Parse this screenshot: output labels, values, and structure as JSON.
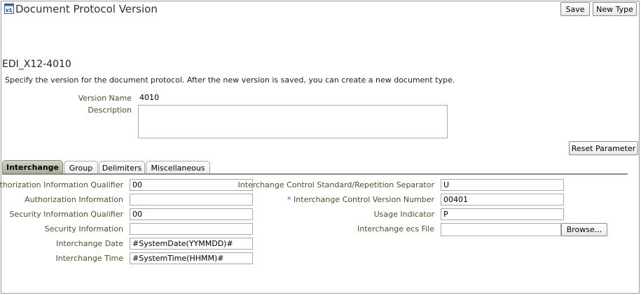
{
  "header": {
    "title": "Document Protocol Version",
    "save_label": "Save",
    "new_type_label": "New Type"
  },
  "section": {
    "title": "EDI_X12-4010",
    "instructions": "Specify the version for the document protocol. After the new version is saved, you can create a new document type."
  },
  "form": {
    "version_name_label": "Version Name",
    "version_name_value": "4010",
    "description_label": "Description",
    "description_value": "",
    "reset_label": "Reset Parameter"
  },
  "tabs": [
    {
      "label": "Interchange",
      "active": true
    },
    {
      "label": "Group",
      "active": false
    },
    {
      "label": "Delimiters",
      "active": false
    },
    {
      "label": "Miscellaneous",
      "active": false
    }
  ],
  "interchange": {
    "left": [
      {
        "label": "Authorization Information Qualifier",
        "value": "00"
      },
      {
        "label": "Authorization Information",
        "value": ""
      },
      {
        "label": "Security Information Qualifier",
        "value": "00"
      },
      {
        "label": "Security Information",
        "value": ""
      },
      {
        "label": "Interchange Date",
        "value": "#SystemDate(YYMMDD)#"
      },
      {
        "label": "Interchange Time",
        "value": "#SystemTime(HHMM)#"
      }
    ],
    "right": [
      {
        "label": "Interchange Control Standard/Repetition Separator",
        "value": "U"
      },
      {
        "label": "Interchange Control Version Number",
        "value": "00401",
        "required_mark": "*"
      },
      {
        "label": "Usage Indicator",
        "value": "P"
      },
      {
        "label": "Interchange ecs File",
        "value": ""
      }
    ],
    "browse_label": "Browse..."
  },
  "icons": {
    "title_icon": "document-version-icon"
  }
}
